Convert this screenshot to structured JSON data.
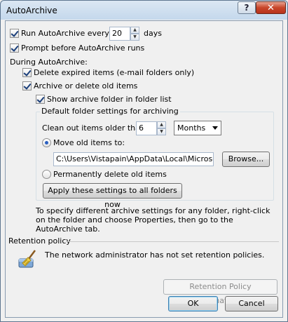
{
  "window": {
    "title": "AutoArchive"
  },
  "titlebar": {
    "help_glyph": "?",
    "close_glyph": "✕"
  },
  "run_autoarchive": {
    "label": "Run AutoArchive every",
    "checked": true,
    "value": "20",
    "unit": "days"
  },
  "prompt_before": {
    "label": "Prompt before AutoArchive runs",
    "checked": true
  },
  "during": {
    "heading": "During AutoArchive:",
    "delete_expired": {
      "label": "Delete expired items (e-mail folders only)",
      "checked": true
    },
    "archive_old": {
      "label": "Archive or delete old items",
      "checked": true
    },
    "show_archive_folder": {
      "label": "Show archive folder in folder list",
      "checked": true
    }
  },
  "defaults": {
    "group_label": "Default folder settings for archiving",
    "clean_out_label": "Clean out items older than",
    "clean_out_value": "6",
    "period_selected": "Months",
    "move_old": {
      "label": "Move old items to:",
      "selected": true
    },
    "archive_path": "C:\\Users\\Vistapain\\AppData\\Local\\Microsoft\\C",
    "browse_label": "Browse...",
    "perm_delete": {
      "label": "Permanently delete old items",
      "selected": false
    },
    "apply_all_label": "Apply these settings to all folders now"
  },
  "info_text": "To specify different archive settings for any folder, right-click on the folder and choose Properties, then go to the AutoArchive tab.",
  "retention": {
    "heading": "Retention policy",
    "message": "The network administrator has not set retention policies.",
    "info_button_label": "Retention Policy Information...",
    "icon": "broom-icon"
  },
  "footer": {
    "ok_label": "OK",
    "cancel_label": "Cancel"
  },
  "colors": {
    "titlebar_top": "#dbe7f3",
    "titlebar_bottom": "#c4d8ec",
    "close_red": "#c8452a",
    "dialog_bg": "#f0f0f0"
  }
}
